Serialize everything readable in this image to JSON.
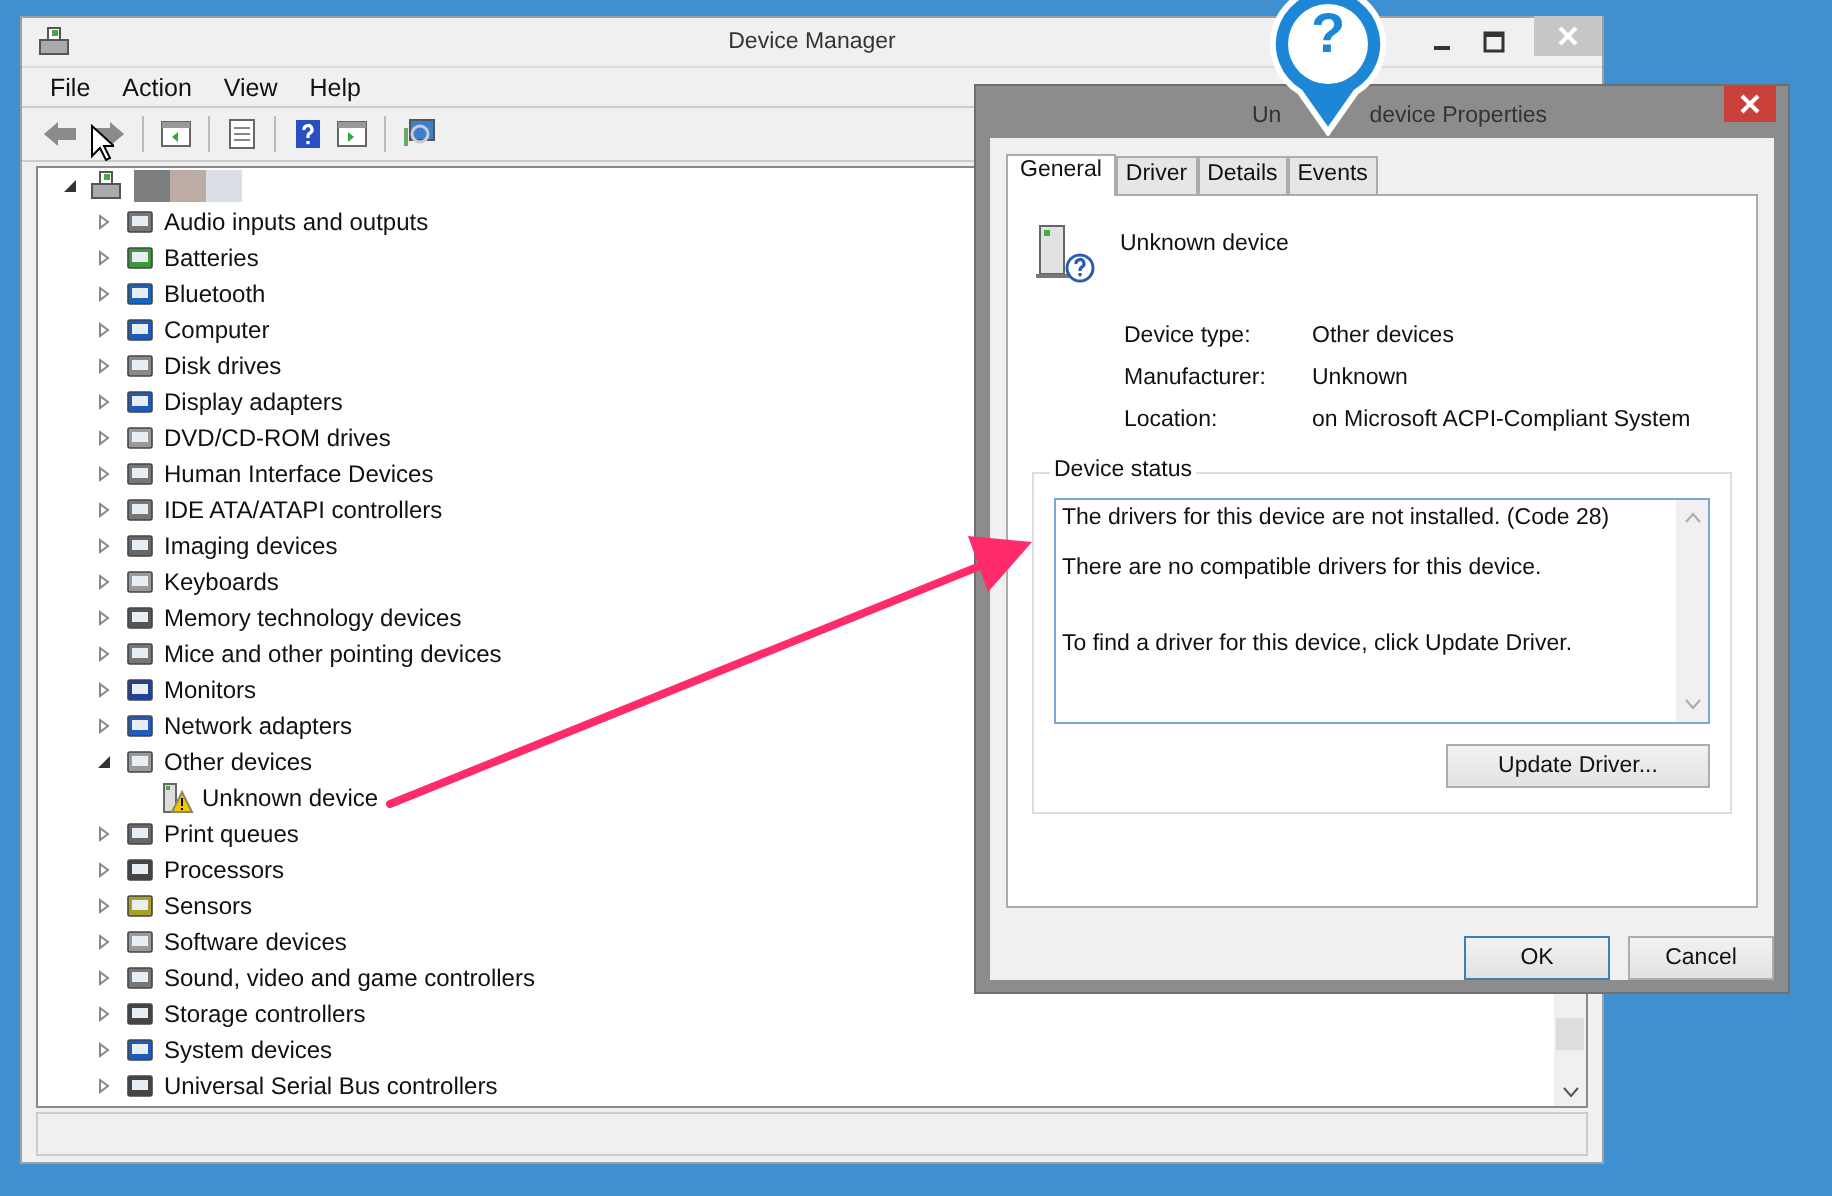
{
  "window": {
    "title": "Device Manager",
    "menu": [
      "File",
      "Action",
      "View",
      "Help"
    ]
  },
  "tree": {
    "root": {
      "expanded": true
    },
    "categories": [
      {
        "label": "Audio inputs and outputs",
        "expanded": false
      },
      {
        "label": "Batteries",
        "expanded": false
      },
      {
        "label": "Bluetooth",
        "expanded": false
      },
      {
        "label": "Computer",
        "expanded": false
      },
      {
        "label": "Disk drives",
        "expanded": false
      },
      {
        "label": "Display adapters",
        "expanded": false
      },
      {
        "label": "DVD/CD-ROM drives",
        "expanded": false
      },
      {
        "label": "Human Interface Devices",
        "expanded": false
      },
      {
        "label": "IDE ATA/ATAPI controllers",
        "expanded": false
      },
      {
        "label": "Imaging devices",
        "expanded": false
      },
      {
        "label": "Keyboards",
        "expanded": false
      },
      {
        "label": "Memory technology devices",
        "expanded": false
      },
      {
        "label": "Mice and other pointing devices",
        "expanded": false
      },
      {
        "label": "Monitors",
        "expanded": false
      },
      {
        "label": "Network adapters",
        "expanded": false
      },
      {
        "label": "Other devices",
        "expanded": true,
        "children": [
          {
            "label": "Unknown device",
            "warning": true
          }
        ]
      },
      {
        "label": "Print queues",
        "expanded": false
      },
      {
        "label": "Processors",
        "expanded": false
      },
      {
        "label": "Sensors",
        "expanded": false
      },
      {
        "label": "Software devices",
        "expanded": false
      },
      {
        "label": "Sound, video and game controllers",
        "expanded": false
      },
      {
        "label": "Storage controllers",
        "expanded": false
      },
      {
        "label": "System devices",
        "expanded": false
      },
      {
        "label": "Universal Serial Bus controllers",
        "expanded": false
      }
    ]
  },
  "dialog": {
    "title_start": "Un",
    "title_end": "device Properties",
    "tabs": [
      {
        "label": "General",
        "selected": true
      },
      {
        "label": "Driver",
        "selected": false
      },
      {
        "label": "Details",
        "selected": false
      },
      {
        "label": "Events",
        "selected": false
      }
    ],
    "device_name": "Unknown device",
    "properties": [
      {
        "label": "Device type:",
        "value": "Other devices"
      },
      {
        "label": "Manufacturer:",
        "value": "Unknown"
      },
      {
        "label": "Location:",
        "value": "on Microsoft ACPI-Compliant System"
      }
    ],
    "status_label": "Device status",
    "status_lines": [
      "The drivers for this device are not installed. (Code 28)",
      "There are no compatible drivers for this device.",
      "To find a driver for this device, click Update Driver."
    ],
    "update_button": "Update Driver...",
    "ok_button": "OK",
    "cancel_button": "Cancel"
  },
  "callout": {
    "symbol": "?"
  }
}
